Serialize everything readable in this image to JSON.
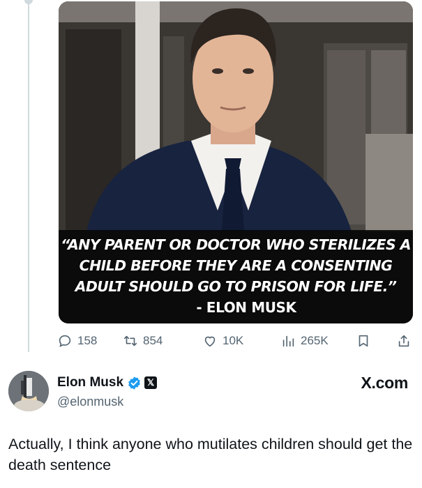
{
  "media": {
    "quote": {
      "lines": [
        "“ANY PARENT OR DOCTOR WHO STERILIZES A",
        "CHILD BEFORE THEY ARE A CONSENTING",
        "ADULT SHOULD GO TO PRISON FOR LIFE.”"
      ],
      "attribution": "- ELON MUSK"
    }
  },
  "actions": {
    "reply": {
      "icon": "reply-icon",
      "count": "158"
    },
    "retweet": {
      "icon": "retweet-icon",
      "count": "854"
    },
    "like": {
      "icon": "heart-icon",
      "count": "10K"
    },
    "views": {
      "icon": "views-icon",
      "count": "265K"
    },
    "bookmark": {
      "icon": "bookmark-icon"
    },
    "share": {
      "icon": "share-icon"
    }
  },
  "author": {
    "name": "Elon Musk",
    "handle": "@elonmusk",
    "site": "X.com"
  },
  "tweet": {
    "text": "Actually, I think anyone who mutilates children should get the death sentence"
  },
  "colors": {
    "text": "#0f1419",
    "muted": "#536471",
    "verified": "#1d9bf0",
    "thread_line": "#cfd9de"
  }
}
